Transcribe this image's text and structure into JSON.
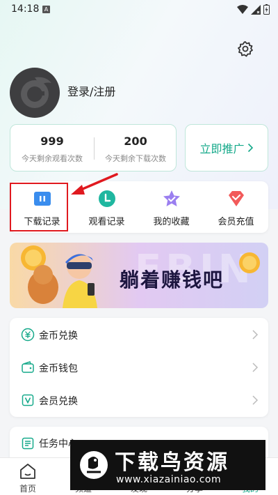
{
  "status_bar": {
    "time": "14:18",
    "a_badge": "A"
  },
  "profile": {
    "login_label": "登录/注册"
  },
  "stats": [
    {
      "value": "999",
      "label": "今天剩余观看次数"
    },
    {
      "value": "200",
      "label": "今天剩余下载次数"
    }
  ],
  "promote": {
    "label": "立即推广"
  },
  "quick_actions": [
    {
      "label": "下载记录",
      "icon": "download-record-icon"
    },
    {
      "label": "观看记录",
      "icon": "watch-history-icon"
    },
    {
      "label": "我的收藏",
      "icon": "favorites-icon"
    },
    {
      "label": "会员充值",
      "icon": "vip-recharge-icon"
    }
  ],
  "banner": {
    "text": "躺着赚钱吧",
    "ghost_text": "EBIN"
  },
  "menu": [
    {
      "label": "金币兑换",
      "icon": "coin-exchange-icon"
    },
    {
      "label": "金币钱包",
      "icon": "wallet-icon"
    },
    {
      "label": "会员兑换",
      "icon": "vip-exchange-icon"
    }
  ],
  "task": {
    "label": "任务中心"
  },
  "tabs": [
    {
      "label": "首页",
      "icon": "home-icon",
      "active": false
    },
    {
      "label": "频道",
      "icon": "channel-icon",
      "active": false
    },
    {
      "label": "发现",
      "icon": "discover-icon",
      "active": false
    },
    {
      "label": "分享",
      "icon": "share-icon",
      "active": false
    },
    {
      "label": "我的",
      "icon": "profile-icon",
      "active": true
    }
  ],
  "watermark": {
    "title": "下载鸟资源",
    "url": "www.xiazainiao.com"
  },
  "colors": {
    "accent": "#15a98a",
    "highlight": "#e0191f",
    "stat_border": "#bfe6da"
  }
}
